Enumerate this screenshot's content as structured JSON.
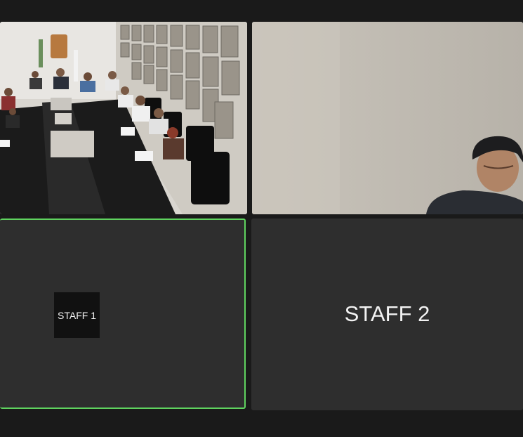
{
  "app": "video-conference-gallery",
  "tiles": [
    {
      "id": "conference-room",
      "kind": "video",
      "label": ""
    },
    {
      "id": "webcam",
      "kind": "video",
      "label": ""
    },
    {
      "id": "staff-1",
      "kind": "avatar",
      "label": "STAFF 1",
      "active_speaker": true
    },
    {
      "id": "staff-2",
      "kind": "name",
      "label": "STAFF 2",
      "active_speaker": false
    }
  ],
  "colors": {
    "background": "#1a1a1a",
    "tile": "#2e2e2e",
    "active_border": "#5fd35f",
    "text": "#f2f2f2"
  }
}
